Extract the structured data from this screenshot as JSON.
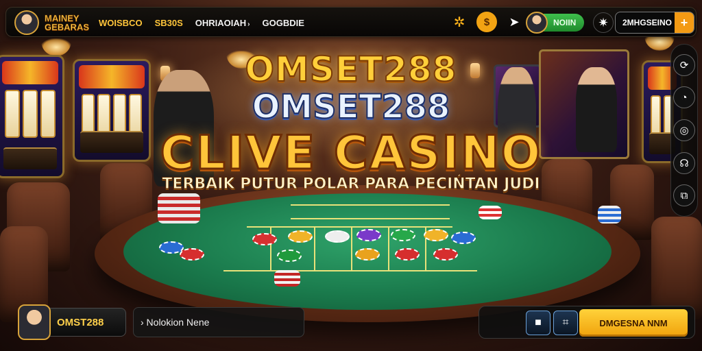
{
  "topbar": {
    "brand": "MAINEY GEBARAS",
    "nav": [
      {
        "label": "WOISBCO",
        "style": "gold"
      },
      {
        "label": "SB30S",
        "style": "gold"
      },
      {
        "label": "OHRIAOIAH",
        "style": "white",
        "caret": "›"
      },
      {
        "label": "GOGBDIE",
        "style": "white"
      }
    ],
    "coin_label": "$",
    "user_label": "NOIIN",
    "balance_text": "2MHGSEINO",
    "balance_plus": "+"
  },
  "headline": {
    "line1": "OMSET288",
    "line2": "OMSET288",
    "line3": "CLIVE CASINO",
    "tagline": "TERBAIK PUTUR POLAR PARA PECIŃTAN JUDI"
  },
  "bottombar": {
    "player_name": "OMST288",
    "message": "› Nolokion Nene",
    "cta_label": "DMGESNA NNM"
  },
  "icons": {
    "gear": "gear-icon",
    "coin": "coin-icon",
    "send": "send-icon",
    "settings": "settings-icon",
    "rail": [
      "refresh-icon",
      "gauge-icon",
      "chat-icon",
      "headset-icon",
      "split-screen-icon"
    ],
    "bottom": [
      "stop-icon",
      "crop-icon"
    ]
  },
  "colors": {
    "accent_gold": "#ffc53a",
    "accent_orange": "#f39a14",
    "accent_green": "#2fa84a",
    "felt": "#1a7a4c"
  }
}
